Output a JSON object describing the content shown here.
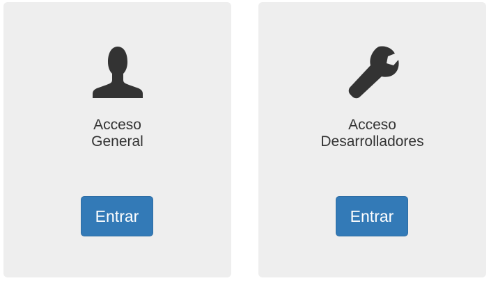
{
  "cards": [
    {
      "icon": "user-icon",
      "title_line1": "Acceso",
      "title_line2": "General",
      "button_label": "Entrar"
    },
    {
      "icon": "wrench-icon",
      "title_line1": "Acceso",
      "title_line2": "Desarrolladores",
      "button_label": "Entrar"
    }
  ],
  "colors": {
    "card_background": "#eeeeee",
    "button_primary": "#337ab7",
    "icon": "#333333",
    "text": "#333333"
  }
}
